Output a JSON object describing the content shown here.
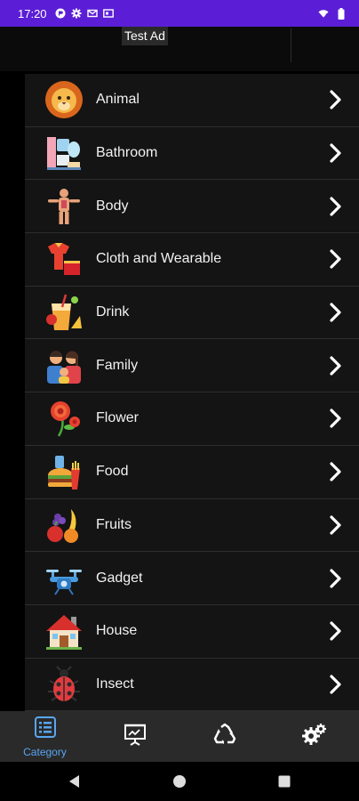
{
  "status_bar": {
    "time": "17:20",
    "left_icons": [
      "app-icon",
      "settings-icon",
      "mail-icon",
      "card-icon"
    ],
    "right_icons": [
      "wifi-icon",
      "battery-icon"
    ],
    "color": "#5b1ed6"
  },
  "ad": {
    "label": "Test Ad"
  },
  "categories": [
    {
      "label": "Animal",
      "icon": "lion-icon"
    },
    {
      "label": "Bathroom",
      "icon": "bathroom-icon"
    },
    {
      "label": "Body",
      "icon": "body-icon"
    },
    {
      "label": "Cloth and Wearable",
      "icon": "clothes-icon"
    },
    {
      "label": "Drink",
      "icon": "drink-icon"
    },
    {
      "label": "Family",
      "icon": "family-icon"
    },
    {
      "label": "Flower",
      "icon": "flower-icon"
    },
    {
      "label": "Food",
      "icon": "food-icon"
    },
    {
      "label": "Fruits",
      "icon": "fruits-icon"
    },
    {
      "label": "Gadget",
      "icon": "drone-icon"
    },
    {
      "label": "House",
      "icon": "house-icon"
    },
    {
      "label": "Insect",
      "icon": "ladybug-icon"
    }
  ],
  "bottom_nav": {
    "items": [
      {
        "label": "Category",
        "icon": "list-icon",
        "active": true
      },
      {
        "label": "",
        "icon": "presentation-icon",
        "active": false
      },
      {
        "label": "",
        "icon": "recycle-icon",
        "active": false
      },
      {
        "label": "",
        "icon": "gears-icon",
        "active": false
      }
    ],
    "accent": "#58a6f2"
  },
  "system_nav": {
    "buttons": [
      "back-icon",
      "home-icon",
      "recents-icon"
    ]
  }
}
